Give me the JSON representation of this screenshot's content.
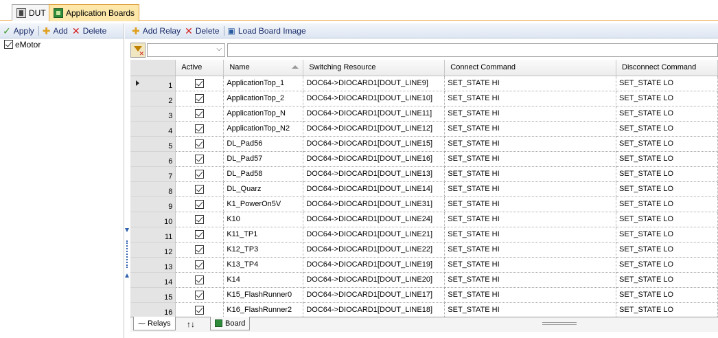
{
  "top_tabs": [
    {
      "label": "DUT",
      "icon": "dut-chip-icon"
    },
    {
      "label": "Application Boards",
      "icon": "board-icon"
    }
  ],
  "left_toolbar": {
    "apply": "Apply",
    "add": "Add",
    "delete": "Delete"
  },
  "tree": {
    "items": [
      {
        "label": "eMotor",
        "checked": true
      }
    ]
  },
  "right_toolbar": {
    "add_relay": "Add Relay",
    "delete": "Delete",
    "load_board_image": "Load Board Image"
  },
  "filter": {
    "combo_value": "",
    "text_value": ""
  },
  "grid": {
    "columns": [
      "Active",
      "Name",
      "Switching Resource",
      "Connect Command",
      "Disconnect Command"
    ],
    "sorted_column": "Name",
    "rows": [
      {
        "num": "1",
        "name": "ApplicationTop_1",
        "resource": "DOC64->DIOCARD1[DOUT_LINE9]",
        "connect": "SET_STATE HI",
        "disconnect": "SET_STATE LO"
      },
      {
        "num": "2",
        "name": "ApplicationTop_2",
        "resource": "DOC64->DIOCARD1[DOUT_LINE10]",
        "connect": "SET_STATE HI",
        "disconnect": "SET_STATE LO"
      },
      {
        "num": "3",
        "name": "ApplicationTop_N",
        "resource": "DOC64->DIOCARD1[DOUT_LINE11]",
        "connect": "SET_STATE HI",
        "disconnect": "SET_STATE LO"
      },
      {
        "num": "4",
        "name": "ApplicationTop_N2",
        "resource": "DOC64->DIOCARD1[DOUT_LINE12]",
        "connect": "SET_STATE HI",
        "disconnect": "SET_STATE LO"
      },
      {
        "num": "5",
        "name": "DL_Pad56",
        "resource": "DOC64->DIOCARD1[DOUT_LINE15]",
        "connect": "SET_STATE HI",
        "disconnect": "SET_STATE LO"
      },
      {
        "num": "6",
        "name": "DL_Pad57",
        "resource": "DOC64->DIOCARD1[DOUT_LINE16]",
        "connect": "SET_STATE HI",
        "disconnect": "SET_STATE LO"
      },
      {
        "num": "7",
        "name": "DL_Pad58",
        "resource": "DOC64->DIOCARD1[DOUT_LINE13]",
        "connect": "SET_STATE HI",
        "disconnect": "SET_STATE LO"
      },
      {
        "num": "8",
        "name": "DL_Quarz",
        "resource": "DOC64->DIOCARD1[DOUT_LINE14]",
        "connect": "SET_STATE HI",
        "disconnect": "SET_STATE LO"
      },
      {
        "num": "9",
        "name": "K1_PowerOn5V",
        "resource": "DOC64->DIOCARD1[DOUT_LINE31]",
        "connect": "SET_STATE HI",
        "disconnect": "SET_STATE LO"
      },
      {
        "num": "10",
        "name": "K10",
        "resource": "DOC64->DIOCARD1[DOUT_LINE24]",
        "connect": "SET_STATE HI",
        "disconnect": "SET_STATE LO"
      },
      {
        "num": "11",
        "name": "K11_TP1",
        "resource": "DOC64->DIOCARD1[DOUT_LINE21]",
        "connect": "SET_STATE HI",
        "disconnect": "SET_STATE LO"
      },
      {
        "num": "12",
        "name": "K12_TP3",
        "resource": "DOC64->DIOCARD1[DOUT_LINE22]",
        "connect": "SET_STATE HI",
        "disconnect": "SET_STATE LO"
      },
      {
        "num": "13",
        "name": "K13_TP4",
        "resource": "DOC64->DIOCARD1[DOUT_LINE19]",
        "connect": "SET_STATE HI",
        "disconnect": "SET_STATE LO"
      },
      {
        "num": "14",
        "name": "K14",
        "resource": "DOC64->DIOCARD1[DOUT_LINE20]",
        "connect": "SET_STATE HI",
        "disconnect": "SET_STATE LO"
      },
      {
        "num": "15",
        "name": "K15_FlashRunner0",
        "resource": "DOC64->DIOCARD1[DOUT_LINE17]",
        "connect": "SET_STATE HI",
        "disconnect": "SET_STATE LO"
      },
      {
        "num": "16",
        "name": "K16_FlashRunner2",
        "resource": "DOC64->DIOCARD1[DOUT_LINE18]",
        "connect": "SET_STATE HI",
        "disconnect": "SET_STATE LO"
      }
    ]
  },
  "bottom_tabs": {
    "relays": "Relays",
    "sort_toggle": "↑↓",
    "board": "Board"
  }
}
